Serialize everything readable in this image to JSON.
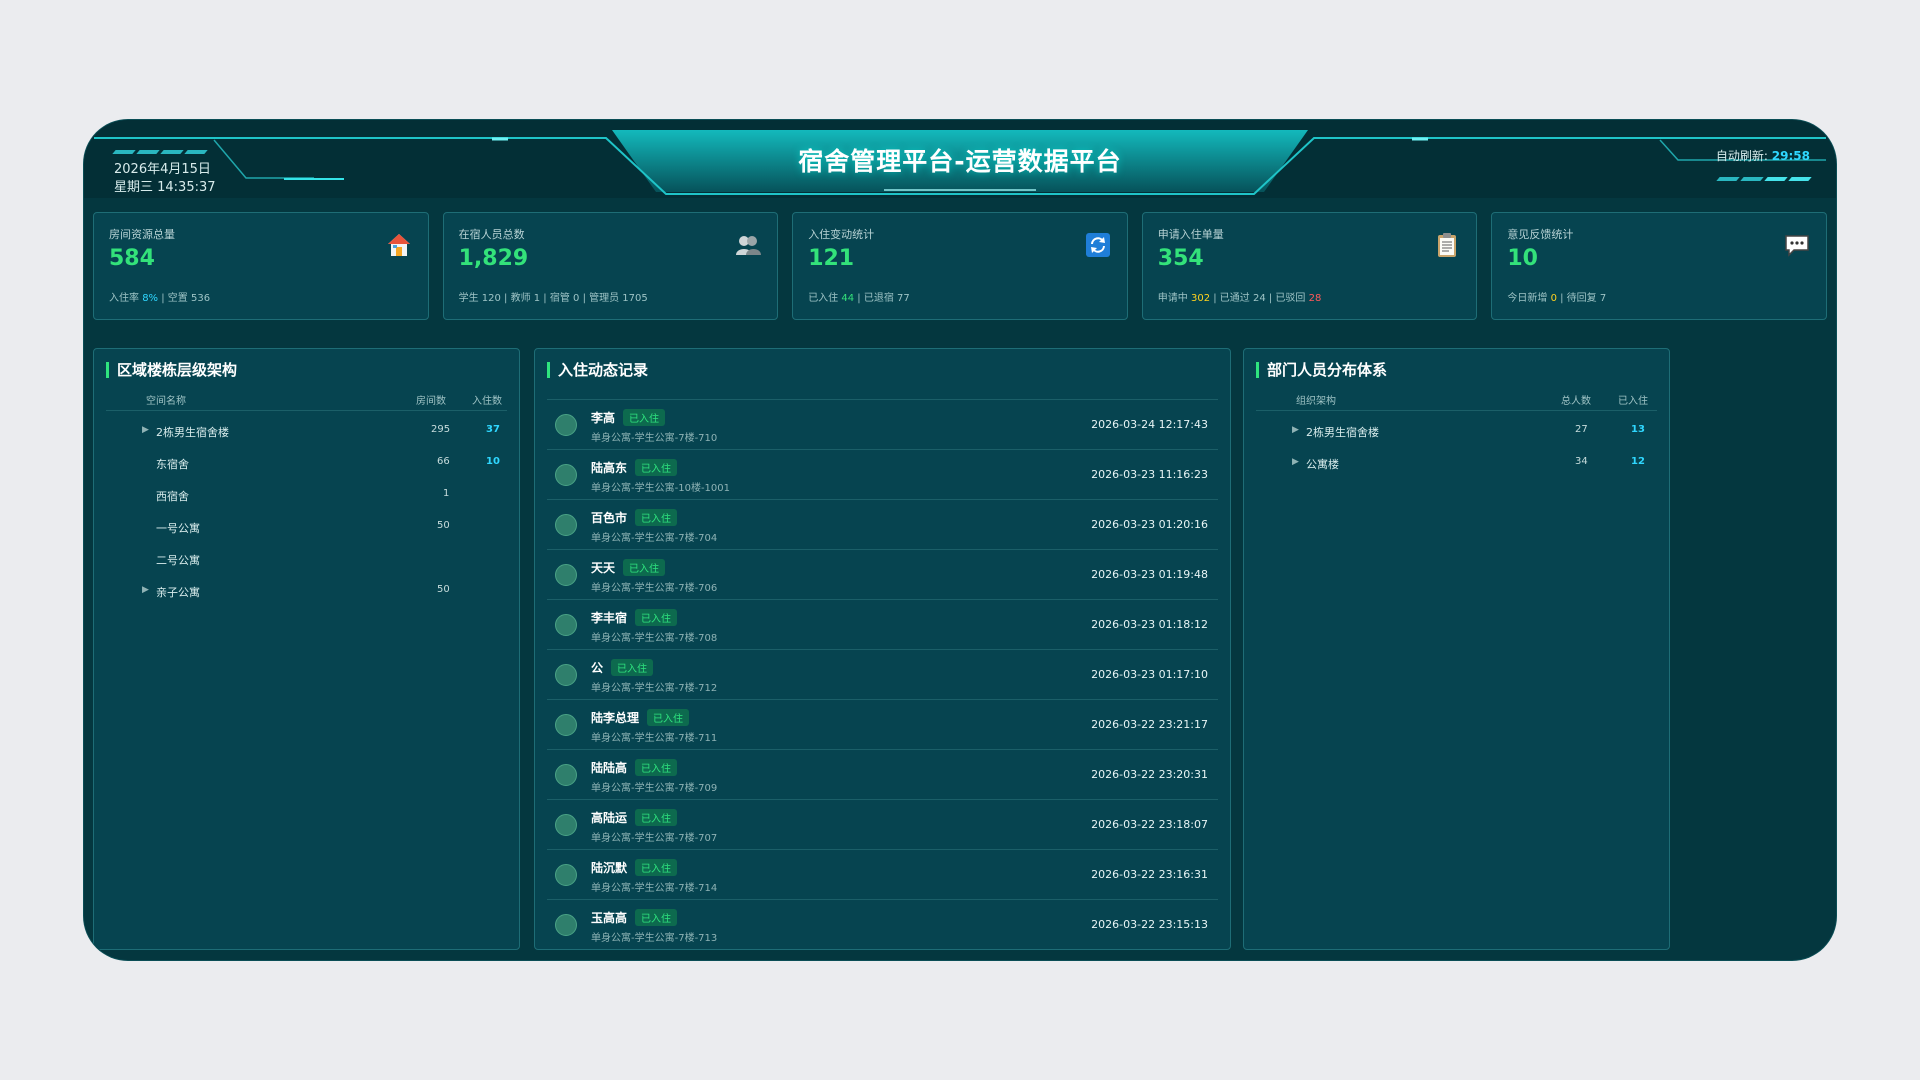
{
  "header": {
    "date": "2026年4月15日",
    "weekday_time": "星期三 14:35:37",
    "title": "宿舍管理平台-运营数据平台",
    "refresh_label": "自动刷新:",
    "refresh_countdown": "29:58"
  },
  "cards": [
    {
      "label": "房间资源总量",
      "value": "584",
      "icon": "house-icon",
      "sub": [
        {
          "t": "入住率 "
        },
        {
          "t": "8%",
          "c": "c"
        },
        {
          "t": " | 空置 536"
        }
      ]
    },
    {
      "label": "在宿人员总数",
      "value": "1,829",
      "icon": "people-icon",
      "sub": [
        {
          "t": "学生 120 | 教师 1 | 宿管 0 | 管理员 1705"
        }
      ]
    },
    {
      "label": "入住变动统计",
      "value": "121",
      "icon": "refresh-icon",
      "sub": [
        {
          "t": "已入住 "
        },
        {
          "t": "44",
          "c": "g"
        },
        {
          "t": " | 已退宿 77"
        }
      ]
    },
    {
      "label": "申请入住单量",
      "value": "354",
      "icon": "clipboard-icon",
      "sub": [
        {
          "t": "申请中 "
        },
        {
          "t": "302",
          "c": "y"
        },
        {
          "t": " | 已通过 24 | 已驳回 "
        },
        {
          "t": "28",
          "c": "r"
        }
      ]
    },
    {
      "label": "意见反馈统计",
      "value": "10",
      "icon": "chat-icon",
      "sub": [
        {
          "t": "今日新增 "
        },
        {
          "t": "0",
          "c": "y"
        },
        {
          "t": " | 待回复 7"
        }
      ]
    }
  ],
  "left_panel": {
    "title": "区域楼栋层级架构",
    "col_name": "空间名称",
    "col_rooms": "房间数",
    "col_occupied": "入住数",
    "rows": [
      {
        "name": "2栋男生宿舍楼",
        "rooms": "295",
        "occupied": "37",
        "expandable": true
      },
      {
        "name": "东宿舍",
        "rooms": "66",
        "occupied": "10",
        "expandable": false
      },
      {
        "name": "西宿舍",
        "rooms": "1",
        "occupied": "",
        "expandable": false
      },
      {
        "name": "一号公寓",
        "rooms": "50",
        "occupied": "",
        "expandable": false
      },
      {
        "name": "二号公寓",
        "rooms": "",
        "occupied": "",
        "expandable": false
      },
      {
        "name": "亲子公寓",
        "rooms": "50",
        "occupied": "",
        "expandable": true
      }
    ]
  },
  "mid_panel": {
    "title": "入住动态记录",
    "records": [
      {
        "name": "李高",
        "status": "已入住",
        "location": "单身公寓-学生公寓-7楼-710",
        "time": "2026-03-24 12:17:43"
      },
      {
        "name": "陆高东",
        "status": "已入住",
        "location": "单身公寓-学生公寓-10楼-1001",
        "time": "2026-03-23 11:16:23"
      },
      {
        "name": "百色市",
        "status": "已入住",
        "location": "单身公寓-学生公寓-7楼-704",
        "time": "2026-03-23 01:20:16"
      },
      {
        "name": "天天",
        "status": "已入住",
        "location": "单身公寓-学生公寓-7楼-706",
        "time": "2026-03-23 01:19:48"
      },
      {
        "name": "李丰宿",
        "status": "已入住",
        "location": "单身公寓-学生公寓-7楼-708",
        "time": "2026-03-23 01:18:12"
      },
      {
        "name": "公",
        "status": "已入住",
        "location": "单身公寓-学生公寓-7楼-712",
        "time": "2026-03-23 01:17:10"
      },
      {
        "name": "陆李总理",
        "status": "已入住",
        "location": "单身公寓-学生公寓-7楼-711",
        "time": "2026-03-22 23:21:17"
      },
      {
        "name": "陆陆高",
        "status": "已入住",
        "location": "单身公寓-学生公寓-7楼-709",
        "time": "2026-03-22 23:20:31"
      },
      {
        "name": "高陆运",
        "status": "已入住",
        "location": "单身公寓-学生公寓-7楼-707",
        "time": "2026-03-22 23:18:07"
      },
      {
        "name": "陆沉默",
        "status": "已入住",
        "location": "单身公寓-学生公寓-7楼-714",
        "time": "2026-03-22 23:16:31"
      },
      {
        "name": "玉高高",
        "status": "已入住",
        "location": "单身公寓-学生公寓-7楼-713",
        "time": "2026-03-22 23:15:13"
      }
    ]
  },
  "right_panel": {
    "title": "部门人员分布体系",
    "col_org": "组织架构",
    "col_total": "总人数",
    "col_occupied": "已入住",
    "rows": [
      {
        "name": "2栋男生宿舍楼",
        "total": "27",
        "occupied": "13"
      },
      {
        "name": "公寓楼",
        "total": "34",
        "occupied": "12"
      }
    ]
  },
  "colors": {
    "accent_green": "#33e27a",
    "accent_cyan": "#2fd7ff",
    "panel_bg": "#064450",
    "frame_bg": "#04373f"
  }
}
